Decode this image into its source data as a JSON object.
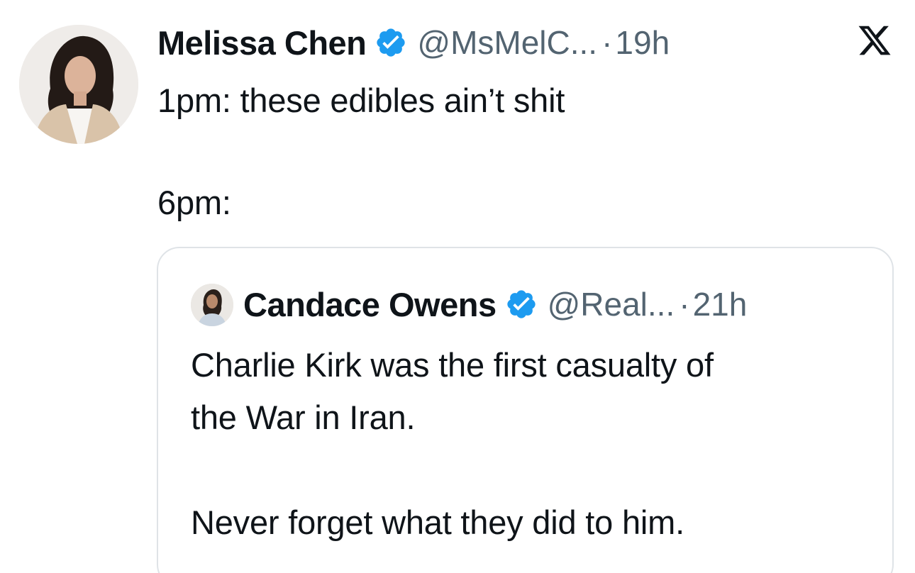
{
  "tweet": {
    "author_name": "Melissa Chen",
    "handle": "@MsMelC...",
    "separator": "·",
    "time": "19h",
    "lines": [
      "1pm: these edibles ain’t shit",
      "",
      "6pm:"
    ],
    "avatar_icon": "profile-photo",
    "verified_icon": "verified-badge-icon",
    "platform_icon": "x-logo-icon"
  },
  "quoted_tweet": {
    "author_name": "Candace Owens",
    "handle": "@Real...",
    "separator": "·",
    "time": "21h",
    "lines": [
      "Charlie Kirk was the first casualty of",
      "the War in Iran.",
      "",
      "Never forget what they did to him."
    ],
    "avatar_icon": "profile-photo",
    "verified_icon": "verified-badge-icon"
  },
  "colors": {
    "text": "#0f1419",
    "secondary_text": "#536471",
    "verified_blue": "#1d9bf0",
    "quote_border": "#dfe3e7"
  }
}
